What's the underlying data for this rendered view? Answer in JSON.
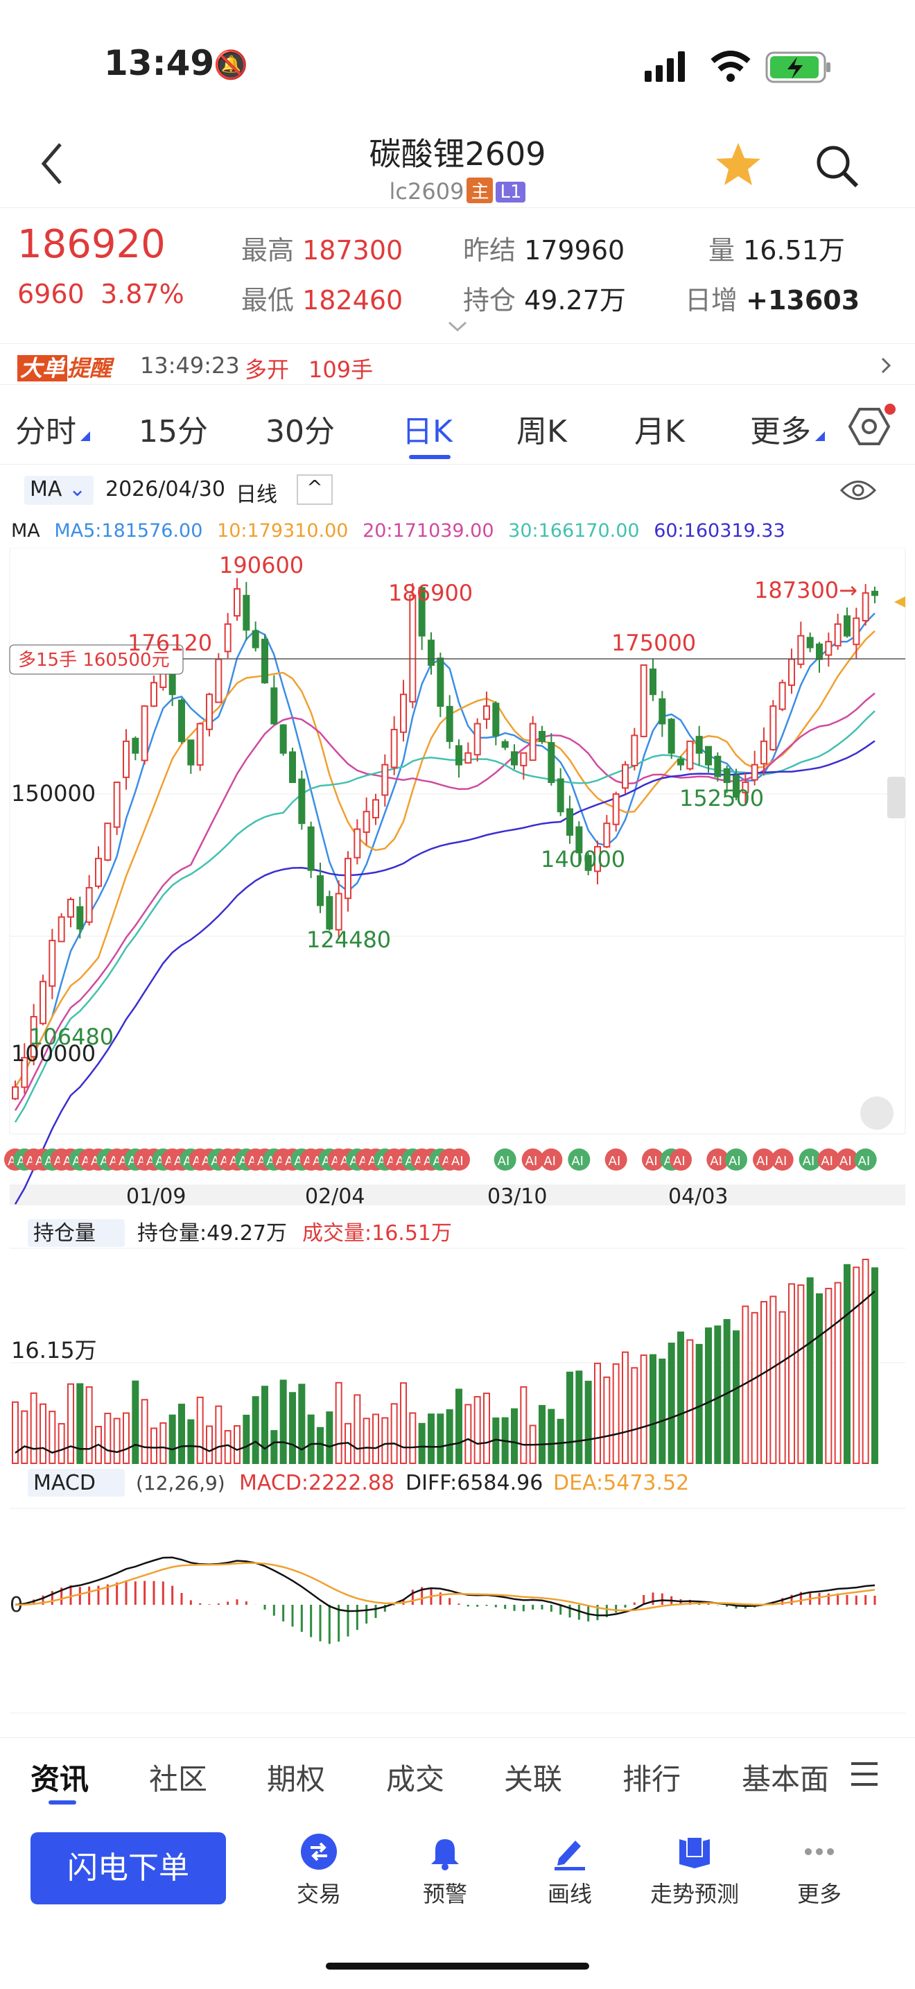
{
  "status_bar": {
    "time": "13:49"
  },
  "nav": {
    "title": "碳酸锂2609",
    "code": "lc2609",
    "tag_main": "主",
    "tag_l1": "L1"
  },
  "quote": {
    "last": "186920",
    "change": "6960",
    "change_pct": "3.87%",
    "high_label": "最高",
    "high": "187300",
    "low_label": "最低",
    "low": "182460",
    "prev_label": "昨结",
    "prev": "179960",
    "oi_label": "持仓",
    "oi": "49.27万",
    "vol_label": "量",
    "vol": "16.51万",
    "daily_inc_label": "日增",
    "daily_inc": "+13603"
  },
  "alert": {
    "badge1": "大单",
    "badge2": "提醒",
    "time": "13:49:23",
    "type": "多开",
    "lots": "109手"
  },
  "tabs": [
    "分时",
    "15分",
    "30分",
    "日K",
    "周K",
    "月K",
    "更多"
  ],
  "active_tab": "日K",
  "chart_bar": {
    "ma_select": "MA",
    "date": "2026/04/30",
    "period": "日线"
  },
  "ma_legend": {
    "label": "MA",
    "ma5": "MA5:181576.00",
    "ma10": "10:179310.00",
    "ma20": "20:171039.00",
    "ma30": "30:166170.00",
    "ma60": "60:160319.33"
  },
  "colors": {
    "ma5": "#3a8ee6",
    "ma10": "#f0a030",
    "ma20": "#d04aa0",
    "ma30": "#44c0b0",
    "ma60": "#3a2ed0",
    "up": "#e03a3a",
    "down": "#2e8b3d",
    "accent": "#3355ee"
  },
  "price_axis": {
    "l150": "150000",
    "l100": "100000"
  },
  "annotations": {
    "p190600": "190600",
    "p186900": "186900",
    "p176120": "176120",
    "p175000": "175000",
    "p187300": "187300→",
    "p152500": "152500",
    "p140000": "140000",
    "p124480": "124480",
    "p106480": "106480"
  },
  "position_label": "多15手 160500元",
  "date_axis": [
    "01/09",
    "02/04",
    "03/10",
    "04/03"
  ],
  "ai_badge": "AI",
  "vol_panel": {
    "select": "持仓量",
    "oi": "持仓量:49.27万",
    "vol": "成交量:16.51万",
    "axis": "16.15万"
  },
  "macd_panel": {
    "select": "MACD",
    "params": "(12,26,9)",
    "macd": "MACD:2222.88",
    "diff": "DIFF:6584.96",
    "dea": "DEA:5473.52",
    "zero": "0"
  },
  "bottom_tabs": [
    "资讯",
    "社区",
    "期权",
    "成交",
    "关联",
    "排行",
    "基本面"
  ],
  "toolbar": {
    "order_button": "闪电下单",
    "items": [
      "交易",
      "预警",
      "画线",
      "走势预测",
      "更多"
    ]
  },
  "chart_data": {
    "type": "candlestick",
    "closes": [
      103000,
      108000,
      115000,
      121000,
      128000,
      132000,
      135000,
      130000,
      137000,
      142000,
      148000,
      155000,
      162000,
      160000,
      168000,
      172000,
      176120,
      170000,
      162000,
      158000,
      165000,
      170000,
      176000,
      182000,
      188000,
      181000,
      178000,
      172000,
      165000,
      160000,
      155000,
      148000,
      140000,
      134000,
      130000,
      136000,
      142000,
      147000,
      150000,
      152000,
      158000,
      164000,
      170000,
      186900,
      180000,
      175000,
      168000,
      162000,
      158000,
      160000,
      165000,
      168000,
      163000,
      161000,
      158000,
      160000,
      165000,
      162000,
      155000,
      150000,
      146000,
      143000,
      140000,
      144000,
      148000,
      153000,
      158000,
      163000,
      175000,
      170000,
      165000,
      160000,
      158000,
      162000,
      160000,
      158000,
      156000,
      155000,
      152500,
      155000,
      158000,
      162000,
      168000,
      172000,
      176000,
      180000,
      178000,
      176000,
      179000,
      182000,
      180000,
      183000,
      187300,
      186920
    ],
    "price_range": [
      95000,
      195000
    ],
    "volume_range": [
      0,
      450000
    ]
  }
}
